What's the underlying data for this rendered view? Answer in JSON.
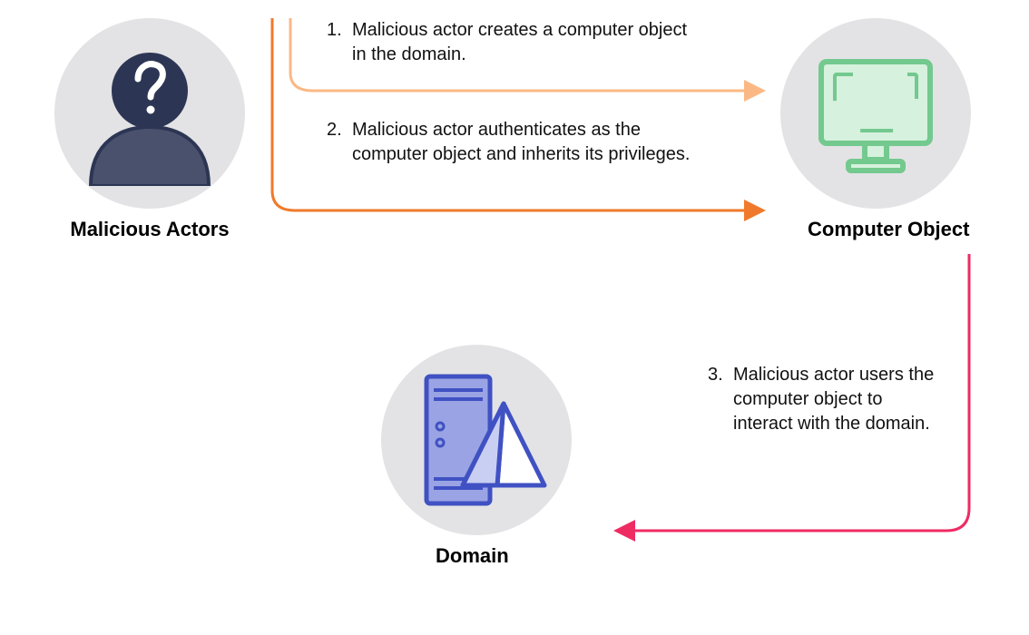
{
  "nodes": {
    "actors": {
      "label": "Malicious Actors"
    },
    "computer": {
      "label": "Computer Object"
    },
    "domain": {
      "label": "Domain"
    }
  },
  "steps": {
    "s1": {
      "num": "1.",
      "text": "Malicious actor creates a computer object in the domain."
    },
    "s2": {
      "num": "2.",
      "text": "Malicious actor authenticates as the computer object and inherits its privileges."
    },
    "s3": {
      "num": "3.",
      "text": "Malicious actor users the computer object to interact with the domain."
    }
  },
  "colors": {
    "arrow_orange_light": "#fbb884",
    "arrow_orange": "#f07a2b",
    "arrow_pink": "#ef2b63",
    "circle_bg": "#e3e3e5",
    "actor_fill": "#4a516d",
    "actor_stroke": "#2c3654",
    "monitor_stroke": "#6fcf8f",
    "monitor_fill": "#d6f1dd",
    "server_stroke": "#4051c3",
    "server_fill": "#9aa4e4"
  }
}
